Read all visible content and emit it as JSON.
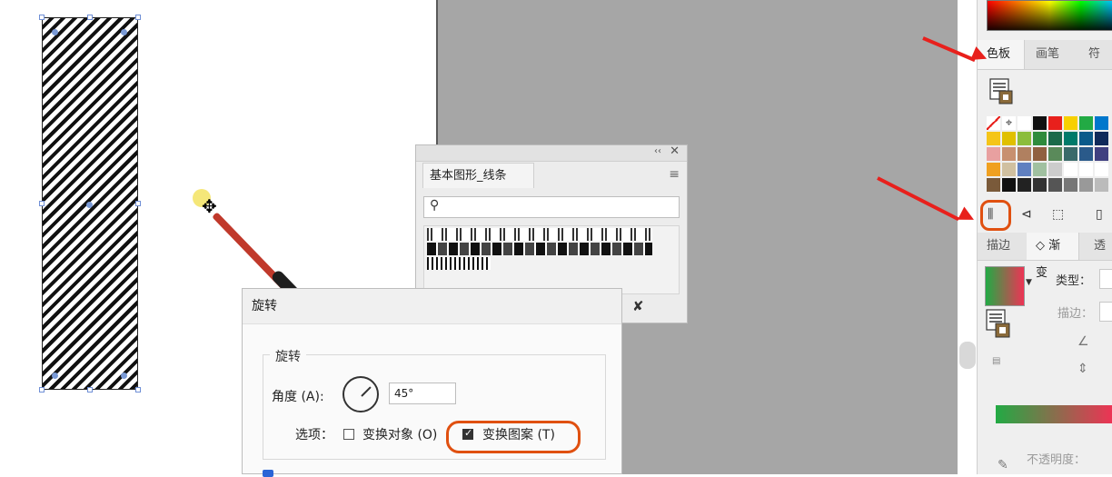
{
  "canvas": {
    "pattern_object": "diagonal-line-pattern-rectangle"
  },
  "symbols_panel": {
    "tab_label": "基本图形_线条",
    "collapse_glyph": "‹‹",
    "close_glyph": "✕",
    "menu_icon": "hamburger-icon",
    "search_icon": "magnifier-icon",
    "search_placeholder": "",
    "pin_icon": "pin-icon"
  },
  "rotate_dialog": {
    "title": "旋转",
    "group_label": "旋转",
    "angle_label": "角度 (A):",
    "angle_value": "45°",
    "options_label": "选项：",
    "transform_objects_label": "变换对象 (O)",
    "transform_objects_checked": false,
    "transform_patterns_label": "变换图案 (T)",
    "transform_patterns_checked": true
  },
  "right_panel": {
    "tabs": [
      "色板",
      "画笔",
      "符"
    ],
    "active_tab": "色板",
    "tabs2": [
      "描边",
      "◇ 渐变",
      "透"
    ],
    "active_tab2": "◇ 渐变",
    "type_label": "类型：",
    "stroke_label": "描边：",
    "opacity_label": "不透明度：",
    "swatch_colors_row1": [
      "#ffffff",
      "#ffffff",
      "#ffffff",
      "#111111",
      "#e8201c",
      "#f7d000",
      "#22aa44",
      "#0077cc"
    ],
    "swatch_colors_row2": [
      "#f5c518",
      "#e0c000",
      "#8bbd3c",
      "#2e8b3c",
      "#1a6a4a",
      "#007a6a",
      "#0a5a8a",
      "#102a5a"
    ],
    "swatch_colors_row3": [
      "#e8a0a0",
      "#c89070",
      "#b08060",
      "#906040",
      "#5a8a5a",
      "#3a6a6a",
      "#2a5a8a",
      "#404080"
    ],
    "swatch_colors_row4": [
      "#f0a020",
      "#d0c0a0",
      "#6080c0",
      "#a0c0a0",
      "#cccccc",
      "#ffffff",
      "#ffffff",
      "#ffffff"
    ],
    "swatch_colors_row5": [
      "#7a5a3a",
      "#111111",
      "#222222",
      "#333333",
      "#555555",
      "#777777",
      "#999999",
      "#bbbbbb"
    ]
  },
  "colors": {
    "highlight": "#e05010",
    "arrow": "#e8201c",
    "gray_workspace": "#a6a6a6"
  }
}
